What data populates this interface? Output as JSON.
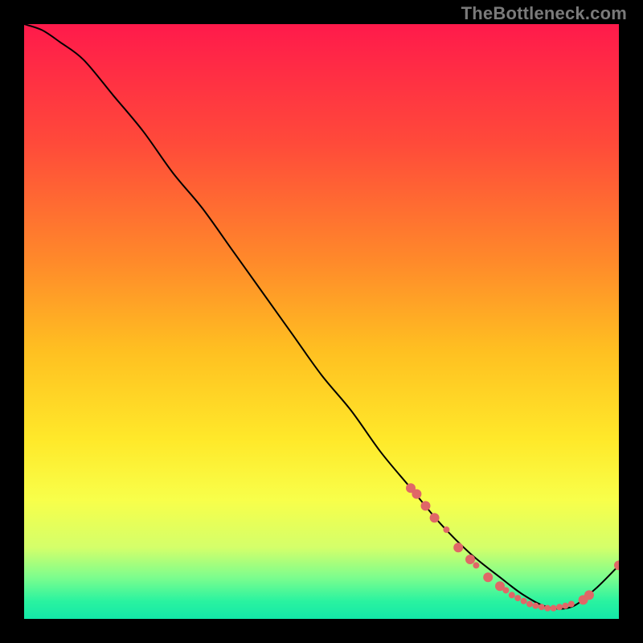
{
  "watermark": "TheBottleneck.com",
  "chart_data": {
    "type": "line",
    "title": "",
    "xlabel": "",
    "ylabel": "",
    "xlim": [
      0,
      100
    ],
    "ylim": [
      0,
      100
    ],
    "grid": false,
    "legend": false,
    "background_gradient": {
      "stops": [
        {
          "offset": 0.0,
          "color": "#ff1a4b"
        },
        {
          "offset": 0.2,
          "color": "#ff4a3a"
        },
        {
          "offset": 0.4,
          "color": "#ff8a2a"
        },
        {
          "offset": 0.55,
          "color": "#ffc021"
        },
        {
          "offset": 0.7,
          "color": "#ffe92a"
        },
        {
          "offset": 0.8,
          "color": "#f8ff4a"
        },
        {
          "offset": 0.88,
          "color": "#d4ff6a"
        },
        {
          "offset": 0.93,
          "color": "#7dfd8d"
        },
        {
          "offset": 0.97,
          "color": "#2af3a0"
        },
        {
          "offset": 1.0,
          "color": "#13e8a8"
        }
      ]
    },
    "series": [
      {
        "name": "bottleneck-curve",
        "color": "#000000",
        "x": [
          0,
          3,
          6,
          10,
          15,
          20,
          25,
          30,
          35,
          40,
          45,
          50,
          55,
          60,
          65,
          70,
          75,
          80,
          84,
          88,
          92,
          96,
          100
        ],
        "y": [
          100,
          99,
          97,
          94,
          88,
          82,
          75,
          69,
          62,
          55,
          48,
          41,
          35,
          28,
          22,
          16,
          11,
          7,
          4,
          2,
          2,
          5,
          9
        ]
      }
    ],
    "markers": {
      "name": "highlight-points",
      "color": "#e06767",
      "radius_primary": 6,
      "radius_secondary": 4,
      "points": [
        {
          "x": 65,
          "y": 22,
          "r": 6
        },
        {
          "x": 66,
          "y": 21,
          "r": 6
        },
        {
          "x": 67.5,
          "y": 19,
          "r": 6
        },
        {
          "x": 69,
          "y": 17,
          "r": 6
        },
        {
          "x": 71,
          "y": 15,
          "r": 4
        },
        {
          "x": 73,
          "y": 12,
          "r": 6
        },
        {
          "x": 75,
          "y": 10,
          "r": 6
        },
        {
          "x": 76,
          "y": 9,
          "r": 4
        },
        {
          "x": 78,
          "y": 7,
          "r": 6
        },
        {
          "x": 80,
          "y": 5.5,
          "r": 6
        },
        {
          "x": 81,
          "y": 4.8,
          "r": 4
        },
        {
          "x": 82,
          "y": 4,
          "r": 4
        },
        {
          "x": 83,
          "y": 3.5,
          "r": 4
        },
        {
          "x": 84,
          "y": 3,
          "r": 4
        },
        {
          "x": 85,
          "y": 2.5,
          "r": 4
        },
        {
          "x": 86,
          "y": 2.2,
          "r": 4
        },
        {
          "x": 87,
          "y": 2,
          "r": 4
        },
        {
          "x": 88,
          "y": 1.8,
          "r": 4
        },
        {
          "x": 89,
          "y": 1.8,
          "r": 4
        },
        {
          "x": 90,
          "y": 2,
          "r": 4
        },
        {
          "x": 91,
          "y": 2.2,
          "r": 4
        },
        {
          "x": 92,
          "y": 2.5,
          "r": 4
        },
        {
          "x": 94,
          "y": 3.2,
          "r": 6
        },
        {
          "x": 95,
          "y": 4,
          "r": 6
        },
        {
          "x": 100,
          "y": 9,
          "r": 6
        }
      ]
    }
  }
}
